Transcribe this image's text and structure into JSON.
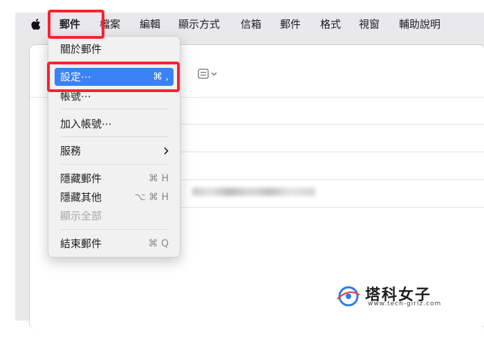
{
  "menubar": {
    "items": [
      "郵件",
      "檔案",
      "編輯",
      "顯示方式",
      "信箱",
      "郵件",
      "格式",
      "視窗",
      "輔助說明"
    ]
  },
  "menu": {
    "items": [
      {
        "label": "關於郵件",
        "shortcut": ""
      },
      {
        "label": "設定⋯",
        "shortcut": "⌘ ,"
      },
      {
        "label": "帳號⋯",
        "shortcut": ""
      },
      {
        "label": "加入帳號⋯",
        "shortcut": ""
      },
      {
        "label": "服務",
        "shortcut": ""
      },
      {
        "label": "隱藏郵件",
        "shortcut": "⌘ H"
      },
      {
        "label": "隱藏其他",
        "shortcut": "⌥ ⌘ H"
      },
      {
        "label": "顯示全部",
        "shortcut": ""
      },
      {
        "label": "結束郵件",
        "shortcut": "⌘ Q"
      }
    ]
  },
  "watermark": {
    "title": "塔科女子",
    "url": "www.tech-girlz.com"
  },
  "colors": {
    "highlight": "#ff1f2f",
    "selection": "#3b82f6",
    "menubar": "#e9e9eb"
  },
  "icons": {
    "apple": "apple-logo-icon",
    "submenu": "chevron-right-icon",
    "toolbar": "list-view-icon"
  }
}
